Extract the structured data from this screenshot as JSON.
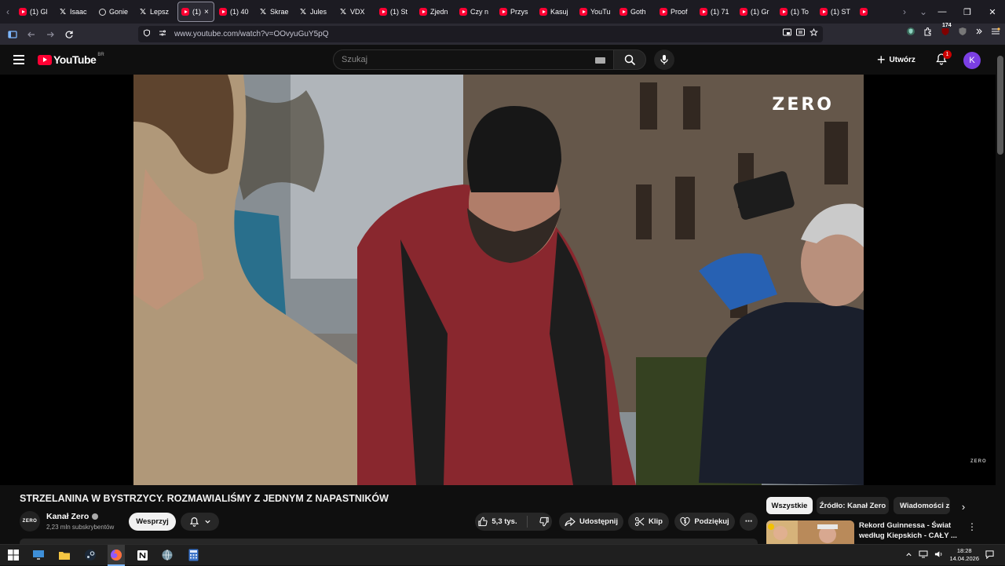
{
  "browser": {
    "tabs": [
      {
        "favicon": "youtube",
        "label": "(1) Gl"
      },
      {
        "favicon": "x",
        "label": "Isaac"
      },
      {
        "favicon": "site",
        "label": "Gonie"
      },
      {
        "favicon": "x",
        "label": "Lepsz"
      },
      {
        "favicon": "youtube",
        "label": "(1)",
        "active": true
      },
      {
        "favicon": "youtube",
        "label": "(1) 40"
      },
      {
        "favicon": "x",
        "label": "Skrae"
      },
      {
        "favicon": "x",
        "label": "Jules"
      },
      {
        "favicon": "x",
        "label": "VDX"
      },
      {
        "favicon": "youtube",
        "label": "(1) St"
      },
      {
        "favicon": "youtube",
        "label": "Zjedn"
      },
      {
        "favicon": "youtube",
        "label": "Czy n"
      },
      {
        "favicon": "youtube",
        "label": "Przys"
      },
      {
        "favicon": "youtube",
        "label": "Kasuj"
      },
      {
        "favicon": "youtube",
        "label": "YouTu"
      },
      {
        "favicon": "youtube",
        "label": "Goth"
      },
      {
        "favicon": "youtube",
        "label": "Proof"
      },
      {
        "favicon": "youtube",
        "label": "(1) 71"
      },
      {
        "favicon": "youtube",
        "label": "(1) Gr"
      },
      {
        "favicon": "youtube",
        "label": "(1) To"
      },
      {
        "favicon": "youtube",
        "label": "(1) ST"
      },
      {
        "favicon": "youtube",
        "label": ""
      }
    ],
    "tab_close": "×",
    "scroll_left": "‹",
    "scroll_right": "›",
    "tab_list": "⌄",
    "url": "www.youtube.com/watch?v=OOvyuGuY5pQ",
    "addon_badge": "174",
    "window_controls": {
      "minimize": "—",
      "maximize": "❐",
      "close": "✕"
    }
  },
  "youtube": {
    "logo_text": "YouTube",
    "country_code": "BR",
    "search_placeholder": "Szukaj",
    "create_label": "Utwórz",
    "notifications_count": "1",
    "avatar_letter": "K"
  },
  "video": {
    "watermark": "ZERO",
    "corner_watermark": "ZERO",
    "title": "STRZELANINA W BYSTRZYCY. ROZMAWIALIŚMY Z JEDNYM Z NAPASTNIKÓW",
    "channel": {
      "avatar_text": "ZERO",
      "name": "Kanał Zero",
      "subscribers": "2,23 mln subskrybentów",
      "support_label": "Wesprzyj"
    },
    "actions": {
      "likes": "5,3 tys.",
      "share": "Udostępnij",
      "clip": "Klip",
      "thanks": "Podziękuj",
      "more": "⋯"
    }
  },
  "sidebar": {
    "chips": [
      "Wszystkie",
      "Źródło: Kanał Zero",
      "Wiadomości z"
    ],
    "chips_next": "›",
    "recommendation": {
      "title": "Rekord Guinnessa - Świat według Kiepskich - CAŁY ...",
      "more": "⋮"
    }
  },
  "taskbar": {
    "time": "18:28",
    "date": "14.04.2026"
  },
  "colors": {
    "youtube_red": "#ff0033",
    "background": "#0f0f0f",
    "avatar": "#7b3fe4"
  }
}
